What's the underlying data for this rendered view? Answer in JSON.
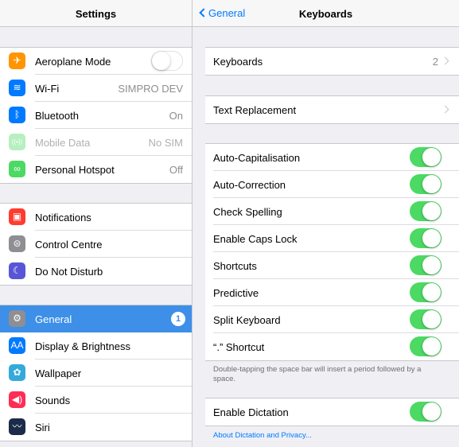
{
  "left": {
    "title": "Settings",
    "group1": [
      {
        "name": "aeroplane-mode",
        "label": "Aeroplane Mode",
        "icon": "airplane-icon",
        "color": "#ff9500",
        "glyph": "✈",
        "toggle": "off"
      },
      {
        "name": "wifi",
        "label": "Wi-Fi",
        "icon": "wifi-icon",
        "color": "#007aff",
        "glyph": "≋",
        "value": "SIMPRO DEV"
      },
      {
        "name": "bluetooth",
        "label": "Bluetooth",
        "icon": "bluetooth-icon",
        "color": "#007aff",
        "glyph": "ᛒ",
        "value": "On"
      },
      {
        "name": "mobile-data",
        "label": "Mobile Data",
        "icon": "antenna-icon",
        "color": "#4cd964",
        "glyph": "((•))",
        "value": "No SIM",
        "dim": true
      },
      {
        "name": "personal-hotspot",
        "label": "Personal Hotspot",
        "icon": "hotspot-icon",
        "color": "#4cd964",
        "glyph": "∞",
        "value": "Off"
      }
    ],
    "group2": [
      {
        "name": "notifications",
        "label": "Notifications",
        "icon": "notifications-icon",
        "color": "#ff3b30",
        "glyph": "▣"
      },
      {
        "name": "control-centre",
        "label": "Control Centre",
        "icon": "control-centre-icon",
        "color": "#8e8e93",
        "glyph": "⊜"
      },
      {
        "name": "do-not-disturb",
        "label": "Do Not Disturb",
        "icon": "moon-icon",
        "color": "#5856d6",
        "glyph": "☾"
      }
    ],
    "group3": [
      {
        "name": "general",
        "label": "General",
        "icon": "gear-icon",
        "color": "#8e8e93",
        "glyph": "⚙",
        "badge": "1",
        "active": true
      },
      {
        "name": "display-brightness",
        "label": "Display & Brightness",
        "icon": "text-size-icon",
        "color": "#007aff",
        "glyph": "AA"
      },
      {
        "name": "wallpaper",
        "label": "Wallpaper",
        "icon": "flower-icon",
        "color": "#34aadc",
        "glyph": "✿"
      },
      {
        "name": "sounds",
        "label": "Sounds",
        "icon": "speaker-icon",
        "color": "#ff2d55",
        "glyph": "◀)"
      },
      {
        "name": "siri",
        "label": "Siri",
        "icon": "siri-icon",
        "color": "#1c2b4a",
        "glyph": "〰"
      }
    ]
  },
  "right": {
    "title": "Keyboards",
    "back_label": "General",
    "keyboards_row": {
      "label": "Keyboards",
      "value": "2"
    },
    "text_replacement": {
      "label": "Text Replacement"
    },
    "toggles": [
      {
        "name": "auto-capitalisation",
        "label": "Auto-Capitalisation",
        "on": true
      },
      {
        "name": "auto-correction",
        "label": "Auto-Correction",
        "on": true
      },
      {
        "name": "check-spelling",
        "label": "Check Spelling",
        "on": true
      },
      {
        "name": "enable-caps-lock",
        "label": "Enable Caps Lock",
        "on": true
      },
      {
        "name": "shortcuts",
        "label": "Shortcuts",
        "on": true
      },
      {
        "name": "predictive",
        "label": "Predictive",
        "on": true
      },
      {
        "name": "split-keyboard",
        "label": "Split Keyboard",
        "on": true
      },
      {
        "name": "period-shortcut",
        "label": "“.” Shortcut",
        "on": true
      }
    ],
    "footnote": "Double-tapping the space bar will insert a period followed by a space.",
    "dictation": {
      "label": "Enable Dictation",
      "on": true
    },
    "dictation_link": "About Dictation and Privacy..."
  },
  "colors": {
    "accent": "#007aff",
    "toggle_on": "#4cd964",
    "selected_row": "#3d8fe8"
  }
}
